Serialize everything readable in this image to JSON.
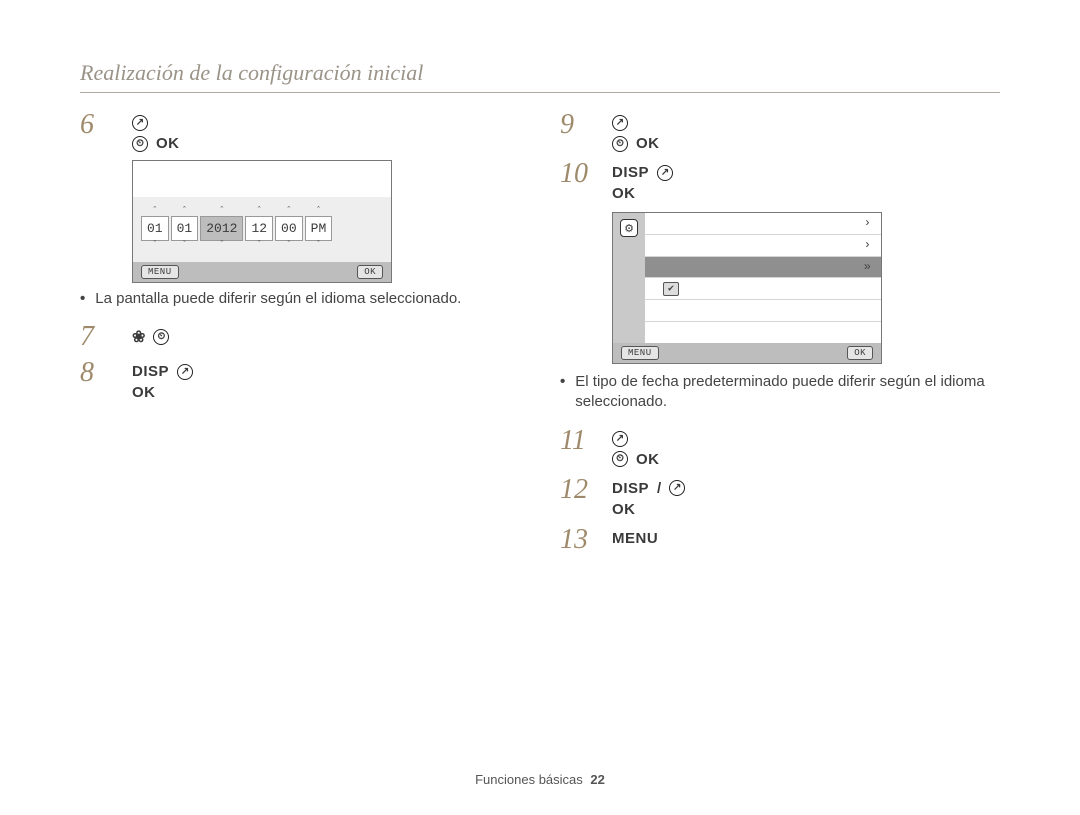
{
  "header": {
    "title": "Realización de la configuración inicial"
  },
  "labels": {
    "ok": "OK",
    "disp": "DISP",
    "menu": "MENU"
  },
  "screen_dt": {
    "fields": [
      "01",
      "01",
      "2012",
      "12",
      "00",
      "PM"
    ],
    "selected_index": 2,
    "btn_menu": "MENU",
    "btn_ok": "OK"
  },
  "notes": {
    "left": "La pantalla puede diferir según el idioma seleccionado.",
    "right": "El tipo de fecha predeterminado puede diferir según el idioma seleccionado."
  },
  "screen_list": {
    "rows": [
      {
        "mark": "none",
        "glyph": "›"
      },
      {
        "mark": "none",
        "glyph": "›"
      },
      {
        "mark": "selected",
        "glyph": "»"
      },
      {
        "mark": "ticked",
        "glyph": ""
      },
      {
        "mark": "none",
        "glyph": ""
      },
      {
        "mark": "none",
        "glyph": ""
      }
    ],
    "btn_menu": "MENU",
    "btn_ok": "OK"
  },
  "steps": {
    "6": "6",
    "7": "7",
    "8": "8",
    "9": "9",
    "10": "10",
    "11": "11",
    "12": "12",
    "13": "13"
  },
  "footer": {
    "section": "Funciones básicas",
    "page": "22"
  }
}
